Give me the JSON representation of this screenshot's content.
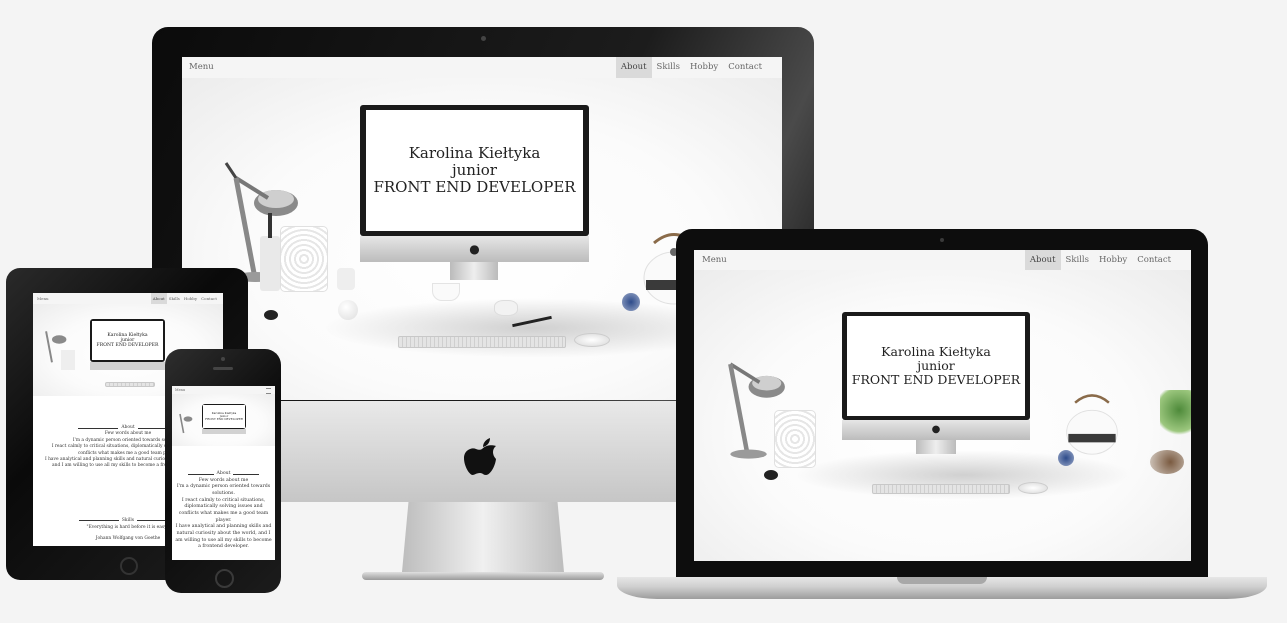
{
  "site": {
    "menu_label": "Menu",
    "nav": [
      "About",
      "Skills",
      "Hobby",
      "Contact"
    ],
    "active_nav": "About",
    "hero": {
      "name": "Karolina Kiełtyka",
      "level": "junior",
      "role": "FRONT END DEVELOPER"
    },
    "about": {
      "heading": "About",
      "intro": "Few words about me",
      "p1": "I'm a dynamic person oriented towards solutions.",
      "p2": "I react calmly to critical situations, diplomatically solving issues and conflicts what makes me a good team player.",
      "p3": "I have analytical and planning skills and natural curiosity about the world, and I am willing to use all my skills to become a frontend developer."
    },
    "skills": {
      "heading": "Skills",
      "quote": "\"Everything is hard before it is easy.\"",
      "author": "Johann Wolfgang von Goethe"
    }
  },
  "colors": {
    "nav_bg": "#f5f5f5",
    "nav_active": "#dadada",
    "bezel": "#111111",
    "page_bg": "#f4f4f4"
  }
}
